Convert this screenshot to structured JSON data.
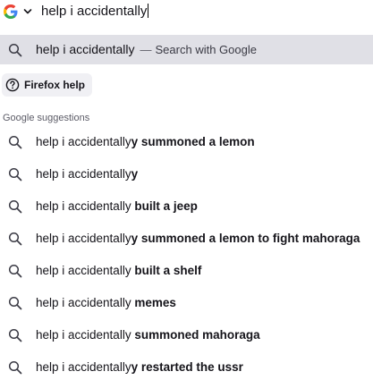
{
  "urlbar": {
    "engine_icon": "google-g-icon",
    "dropdown_icon": "chevron-down-icon",
    "query": "help i accidentally"
  },
  "top_result": {
    "icon": "search-icon",
    "query": "help i accidentally",
    "separator": "—",
    "action": "Search with Google"
  },
  "chip": {
    "icon": "help-circle-icon",
    "label": "Firefox help"
  },
  "section": {
    "title": "Google suggestions"
  },
  "suggestions": [
    {
      "prefix": "help i accidentally",
      "completion": "y summoned a lemon"
    },
    {
      "prefix": "help i accidentally",
      "completion": "y"
    },
    {
      "prefix": "help i accidentally",
      "completion": " built a jeep"
    },
    {
      "prefix": "help i accidentally",
      "completion": "y summoned a lemon to fight mahoraga"
    },
    {
      "prefix": "help i accidentally",
      "completion": " built a shelf"
    },
    {
      "prefix": "help i accidentally",
      "completion": " memes"
    },
    {
      "prefix": "help i accidentally",
      "completion": " summoned mahoraga"
    },
    {
      "prefix": "help i accidentally",
      "completion": "y restarted the ussr"
    }
  ],
  "colors": {
    "selected_row_bg": "#e0e0e6",
    "chip_bg": "#f0f0f4",
    "muted_text": "#5b5b66"
  }
}
